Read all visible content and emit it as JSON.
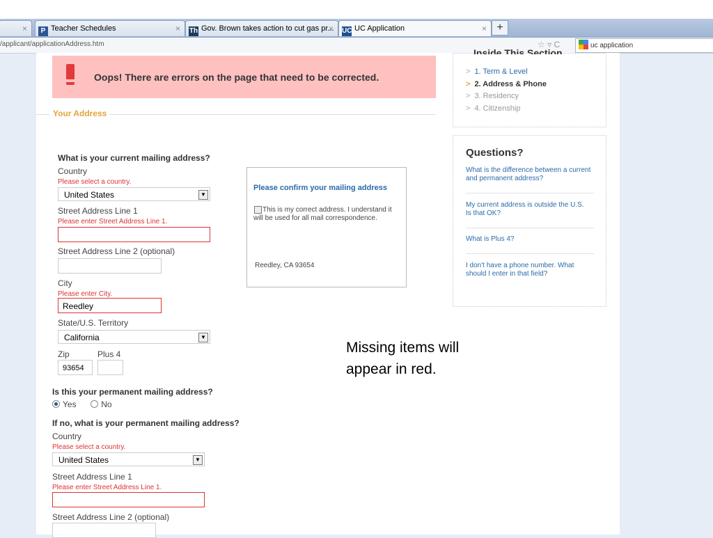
{
  "browser": {
    "tabs": [
      {
        "title": "Teacher Schedules",
        "favicon": "P",
        "favicon_color": "#2b5797"
      },
      {
        "title": "Gov. Brown takes action to cut gas pr...",
        "favicon": "Th",
        "favicon_color": "#1f3a5f"
      },
      {
        "title": "UC Application",
        "favicon": "UC",
        "favicon_color": "#1f4f8f"
      }
    ],
    "new_tab_label": "+",
    "url": "/applicant/applicationAddress.htm",
    "search_text": "uc application",
    "nav_icons": "☆ ▿ C"
  },
  "error_banner": {
    "icon": "exclamation-icon",
    "message": "Oops! There are errors on the page that need to be corrected.",
    "color": "#ffc0c0"
  },
  "section_title": "Your Address",
  "mailing": {
    "question": "What is your current mailing address?",
    "country_label": "Country",
    "country_error": "Please select a country.",
    "country_value": "United States",
    "street1_label": "Street Address Line 1",
    "street1_error": "Please enter Street Address Line 1.",
    "street1_value": "",
    "street2_label": "Street Address Line 2 (optional)",
    "street2_value": "",
    "city_label": "City",
    "city_error": "Please enter City.",
    "city_value": "Reedley",
    "state_label": "State/U.S. Territory",
    "state_value": "California",
    "zip_label": "Zip",
    "zip_value": "93654",
    "plus4_label": "Plus 4",
    "plus4_value": ""
  },
  "confirm": {
    "title": "Please confirm your mailing address",
    "checkbox_text": "This is my correct address. I understand it will be used for all mail correspondence.",
    "checked": false,
    "address": "Reedley, CA 93654"
  },
  "permanent": {
    "question": "Is this your permanent mailing address?",
    "yes_label": "Yes",
    "no_label": "No",
    "selected": "Yes"
  },
  "permanent_address": {
    "question": "If no, what is your permanent mailing address?",
    "country_label": "Country",
    "country_error": "Please select a country.",
    "country_value": "United States",
    "street1_label": "Street Address Line 1",
    "street1_error": "Please enter Street Address Line 1.",
    "street2_label": "Street Address Line 2 (optional)"
  },
  "sidebar": {
    "inside_title": "Inside This Section",
    "steps": [
      {
        "label": "1. Term & Level",
        "state": "link"
      },
      {
        "label": "2. Address & Phone",
        "state": "current"
      },
      {
        "label": "3. Residency",
        "state": "disabled"
      },
      {
        "label": "4. Citizenship",
        "state": "disabled"
      }
    ],
    "questions_title": "Questions?",
    "questions": [
      "What is the difference between a current and permanent address?",
      "My current address is outside the U.S. Is that OK?",
      "What is Plus 4?",
      "I don't have a phone number. What should I enter in that field?"
    ]
  },
  "annotation": {
    "line1": "Missing items will",
    "line2": "appear in red."
  }
}
